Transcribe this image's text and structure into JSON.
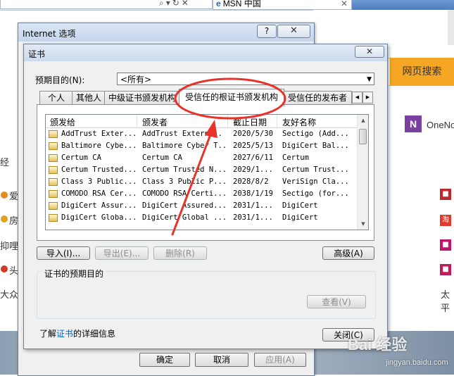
{
  "browser": {
    "tab_title": "MSN 中国",
    "search_button": "网页搜索",
    "onenote_label": "OneNo",
    "left_fragments": [
      "经",
      "爱",
      "房",
      "抑哩",
      "头",
      "大众"
    ],
    "right_fragment": "太平"
  },
  "internet_options": {
    "title": "Internet 选项",
    "help_glyph": "?",
    "close_glyph": "✕",
    "buttons": {
      "ok": "确定",
      "cancel": "取消",
      "apply": "应用(A)"
    }
  },
  "certificates": {
    "title": "证书",
    "close_glyph": "✕",
    "purpose_label": "预期目的(N):",
    "purpose_value": "<所有>",
    "tabs": [
      "个人",
      "其他人",
      "中级证书颁发机构",
      "受信任的根证书颁发机构",
      "受信任的发布者"
    ],
    "columns": [
      "颁发给",
      "颁发者",
      "截止日期",
      "友好名称"
    ],
    "rows": [
      [
        "AddTrust Exter...",
        "AddTrust Extern...",
        "2020/5/30",
        "Sectigo (Add..."
      ],
      [
        "Baltimore Cybe...",
        "Baltimore Cyber T...",
        "2025/5/13",
        "DigiCert Bal..."
      ],
      [
        "Certum CA",
        "Certum CA",
        "2027/6/11",
        "Certum"
      ],
      [
        "Certum Trusted...",
        "Certum Trusted N...",
        "2029/1...",
        "Certum Trust..."
      ],
      [
        "Class 3 Public...",
        "Class 3 Public P...",
        "2028/8/2",
        "VeriSign Cla..."
      ],
      [
        "COMODO RSA Cer...",
        "COMODO RSA Certi...",
        "2038/1/19",
        "Sectigo (for..."
      ],
      [
        "DigiCert Assur...",
        "DigiCert Assured...",
        "2031/1...",
        "DigiCert"
      ],
      [
        "DigiCert Globa...",
        "DigiCert Global ...",
        "2031/1...",
        "DigiCert"
      ]
    ],
    "buttons": {
      "import": "导入(I)...",
      "export": "导出(E)...",
      "remove": "删除(R)",
      "advanced": "高级(A)",
      "view": "查看(V)",
      "close": "关闭(C)"
    },
    "group_title": "证书的预期目的",
    "info_prefix": "了解",
    "info_link": "证书",
    "info_suffix": "的详细信息"
  },
  "watermark": {
    "main": "Bai 经验",
    "sub": "jingyan.baidu.com"
  },
  "colors": {
    "annotation": "#e8322c",
    "search_button": "#f5a623",
    "link": "#0066cc"
  }
}
